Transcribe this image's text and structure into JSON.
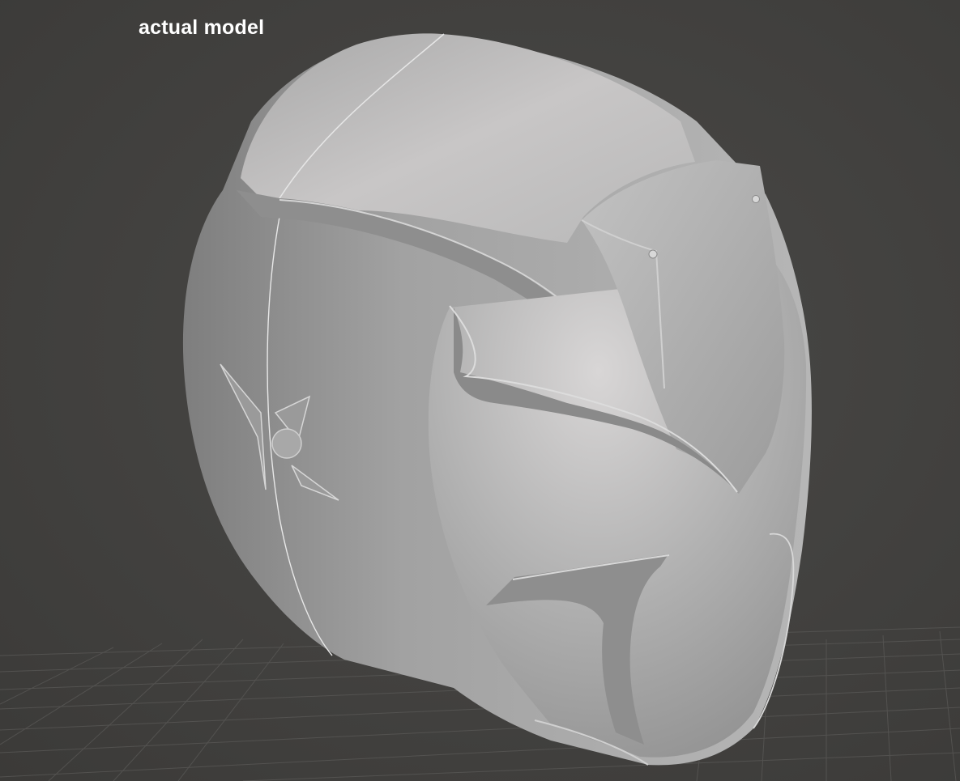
{
  "viewport": {
    "caption": "actual model",
    "background_color": "#403f3d",
    "grid_color": "#5a5957",
    "model_color": "#b4b4b4"
  }
}
